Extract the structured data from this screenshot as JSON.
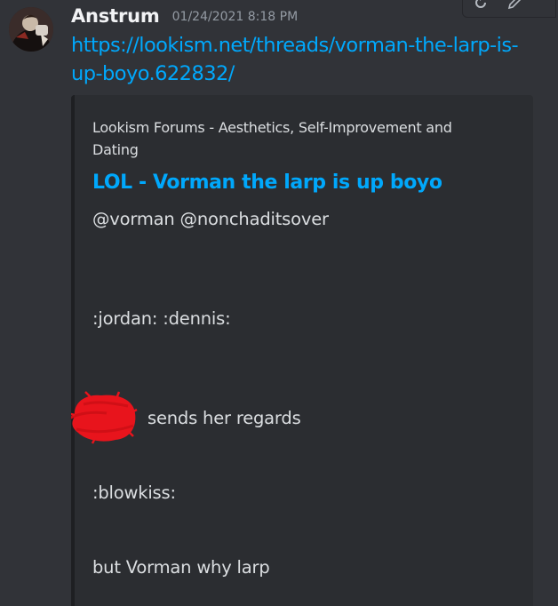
{
  "message": {
    "username": "Anstrum",
    "timestamp": "01/24/2021 8:18 PM",
    "link": "https://lookism.net/threads/vorman-the-larp-is-up-boyo.622832/"
  },
  "embed": {
    "provider": "Lookism Forums - Aesthetics, Self-Improvement and Dating",
    "title": "LOL - Vorman the larp is up boyo",
    "description": [
      "@vorman @nonchaditsover",
      ":jordan: :dennis:",
      "sends her regards",
      ":blowkiss:",
      "but Vorman why larp"
    ]
  },
  "icons": {
    "hover_toolbar": [
      "refresh-icon",
      "edit-icon"
    ]
  },
  "colors": {
    "background": "#313338",
    "embed_background": "#2b2d31",
    "link": "#00a8fc",
    "username": "#f2f3f5",
    "timestamp": "#949ba4",
    "text": "#dbdee1",
    "redaction": "#e8141c"
  }
}
